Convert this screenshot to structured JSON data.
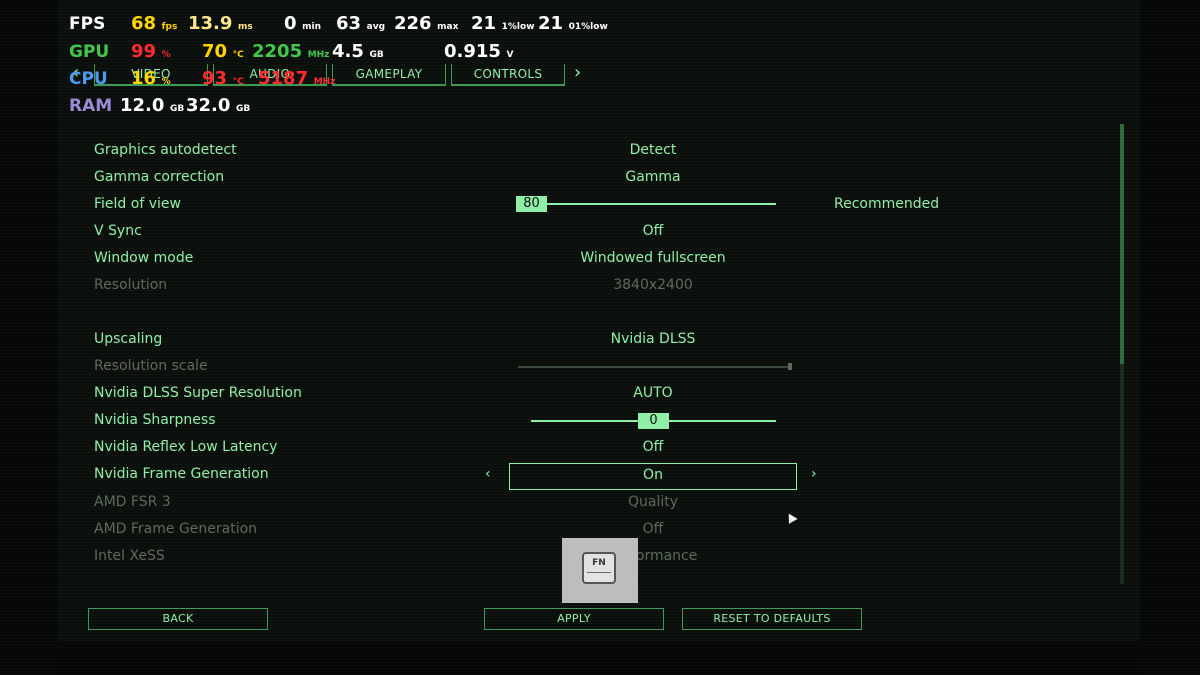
{
  "tabs": {
    "items": [
      "VIDEO",
      "AUDIO",
      "GAMEPLAY",
      "CONTROLS"
    ],
    "prev_arrow": "‹",
    "next_arrow": "›"
  },
  "settings": [
    {
      "label": "Graphics autodetect",
      "value": "Detect"
    },
    {
      "label": "Gamma correction",
      "value": "Gamma"
    },
    {
      "label": "Field of view",
      "value": "80",
      "note": "Recommended"
    },
    {
      "label": "V Sync",
      "value": "Off"
    },
    {
      "label": "Window mode",
      "value": "Windowed fullscreen"
    },
    {
      "label": "Resolution",
      "value": "3840x2400"
    },
    {
      "label": "Upscaling",
      "value": "Nvidia DLSS"
    },
    {
      "label": "Resolution scale",
      "value": ""
    },
    {
      "label": "Nvidia DLSS Super Resolution",
      "value": "AUTO"
    },
    {
      "label": "Nvidia Sharpness",
      "value": "0"
    },
    {
      "label": "Nvidia Reflex Low Latency",
      "value": "Off"
    },
    {
      "label": "Nvidia Frame Generation",
      "value": "On"
    },
    {
      "label": "AMD FSR 3",
      "value": "Quality"
    },
    {
      "label": "AMD Frame Generation",
      "value": "Off"
    },
    {
      "label": "Intel XeSS",
      "value": "Performance"
    }
  ],
  "sliders": {
    "fov_fraction": 0.0,
    "sharpness_fraction": 0.5,
    "resolution_scale_fraction": 1.0
  },
  "buttons": {
    "back": "BACK",
    "apply": "APPLY",
    "reset": "RESET TO DEFAULTS"
  },
  "fn_key": "FN",
  "osd": {
    "fps": {
      "label": "FPS",
      "current": "68",
      "current_unit": "fps",
      "frametime": "13.9",
      "frametime_unit": "ms",
      "min": "0",
      "min_unit": "min",
      "avg": "63",
      "avg_unit": "avg",
      "max": "226",
      "max_unit": "max",
      "low1": "21",
      "low1_unit": "1%low",
      "low01": "21",
      "low01_unit": "01%low"
    },
    "gpu": {
      "label": "GPU",
      "usage": "99",
      "usage_unit": "%",
      "temp": "70",
      "temp_unit": "°C",
      "clock": "2205",
      "clock_unit": "MHz",
      "mem": "4.5",
      "mem_unit": "GB",
      "volt": "0.915",
      "volt_unit": "V"
    },
    "cpu": {
      "label": "CPU",
      "usage": "16",
      "usage_unit": "%",
      "temp": "93",
      "temp_unit": "°C",
      "clock": "5187",
      "clock_unit": "MHz"
    },
    "ram": {
      "label": "RAM",
      "used": "12.0",
      "used_unit": "GB",
      "total": "32.0",
      "total_unit": "GB"
    }
  },
  "colors": {
    "accent": "#8ef0a6",
    "dim": "#5a6a5e",
    "osd_white": "#ffffff",
    "osd_yellow": "#ffd400",
    "osd_red": "#ff2a2a",
    "osd_gpu": "#3fc84a",
    "osd_cpu": "#4a9cf0",
    "osd_ram": "#9a8ad6"
  }
}
